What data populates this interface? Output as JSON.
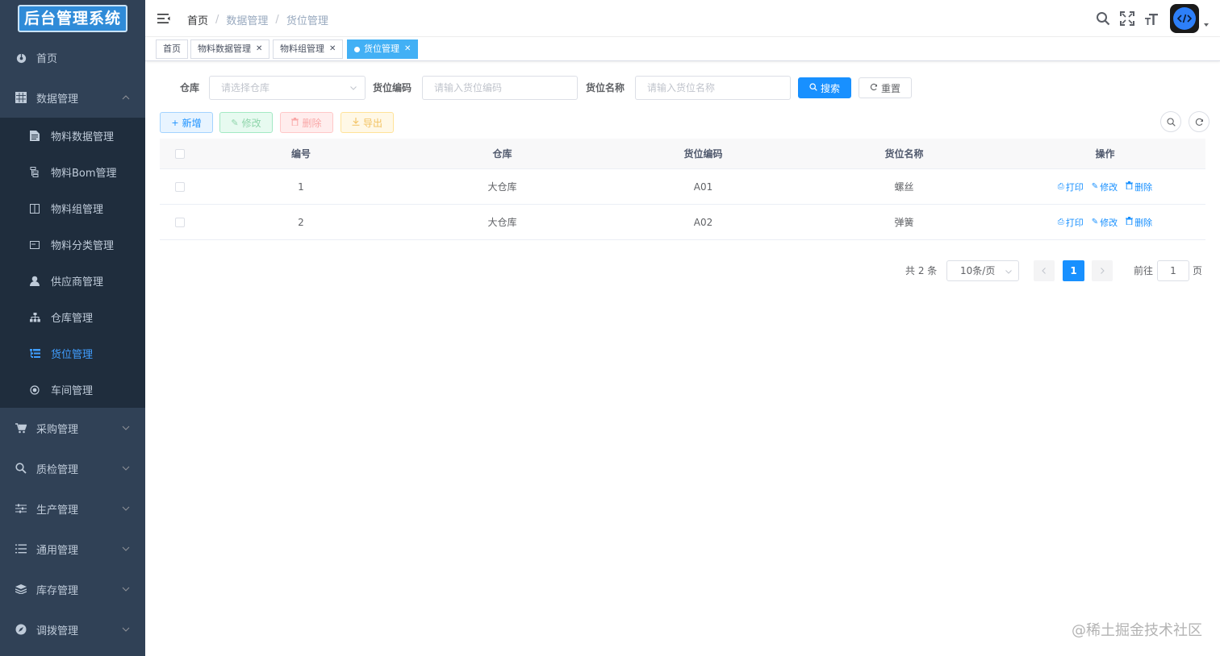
{
  "app": {
    "logo_text": "后台管理系统"
  },
  "sidebar": {
    "items": [
      {
        "label": "首页",
        "icon": "dashboard-icon"
      },
      {
        "label": "数据管理",
        "icon": "table-icon",
        "expanded": true
      },
      {
        "label": "采购管理",
        "icon": "cart-icon"
      },
      {
        "label": "质检管理",
        "icon": "search-icon"
      },
      {
        "label": "生产管理",
        "icon": "sliders-icon"
      },
      {
        "label": "通用管理",
        "icon": "list-icon"
      },
      {
        "label": "库存管理",
        "icon": "stack-icon"
      },
      {
        "label": "调拨管理",
        "icon": "compass-icon"
      }
    ],
    "submenu": [
      {
        "label": "物料数据管理",
        "icon": "document-icon"
      },
      {
        "label": "物料Bom管理",
        "icon": "bom-icon"
      },
      {
        "label": "物料组管理",
        "icon": "group-icon"
      },
      {
        "label": "物料分类管理",
        "icon": "category-icon"
      },
      {
        "label": "供应商管理",
        "icon": "user-icon"
      },
      {
        "label": "仓库管理",
        "icon": "sitemap-icon"
      },
      {
        "label": "货位管理",
        "icon": "tree-table-icon",
        "active": true
      },
      {
        "label": "车间管理",
        "icon": "radio-icon"
      }
    ]
  },
  "navbar": {
    "breadcrumb": [
      "首页",
      "数据管理",
      "货位管理"
    ]
  },
  "tags": [
    {
      "label": "首页"
    },
    {
      "label": "物料数据管理"
    },
    {
      "label": "物料组管理"
    },
    {
      "label": "货位管理",
      "active": true
    }
  ],
  "search_form": {
    "warehouse_label": "仓库",
    "warehouse_placeholder": "请选择仓库",
    "code_label": "货位编码",
    "code_placeholder": "请输入货位编码",
    "name_label": "货位名称",
    "name_placeholder": "请输入货位名称",
    "search_button": "搜索",
    "reset_button": "重置"
  },
  "toolbar": {
    "add": "新增",
    "edit": "修改",
    "delete": "删除",
    "export": "导出"
  },
  "table": {
    "columns": [
      "编号",
      "仓库",
      "货位编码",
      "货位名称",
      "操作"
    ],
    "rows": [
      {
        "id": "1",
        "warehouse": "大仓库",
        "code": "A01",
        "name": "螺丝"
      },
      {
        "id": "2",
        "warehouse": "大仓库",
        "code": "A02",
        "name": "弹簧"
      }
    ],
    "actions": {
      "print": "打印",
      "edit": "修改",
      "delete": "删除"
    }
  },
  "pagination": {
    "total": "共 2 条",
    "page_size": "10条/页",
    "current": "1",
    "goto_label": "前往",
    "goto_value": "1",
    "page_suffix": "页"
  },
  "watermark": "@稀土掘金技术社区",
  "colors": {
    "sidebar_bg": "#304156",
    "submenu_bg": "#1f2d3d",
    "primary": "#1890ff",
    "active_tag": "#42b0f5"
  }
}
